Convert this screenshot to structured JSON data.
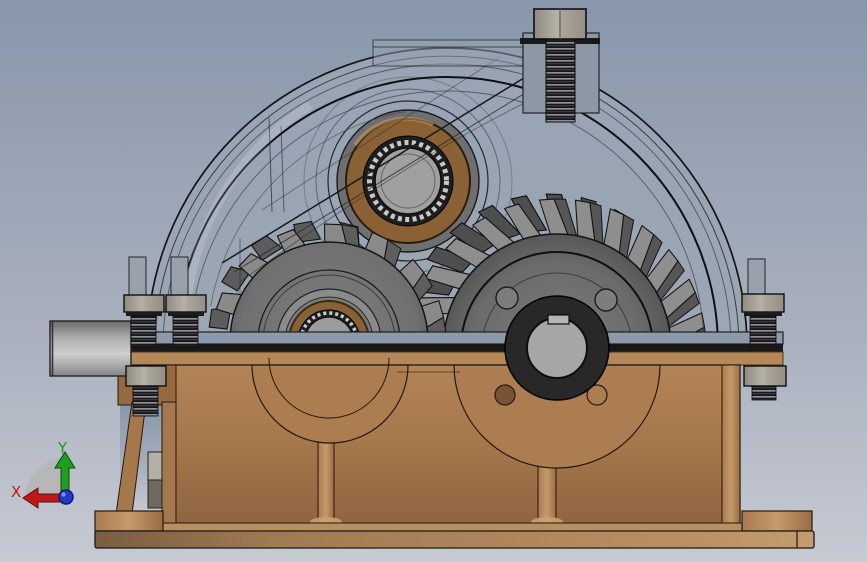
{
  "viewport": {
    "description": "CAD 3D viewport, side view of a single-stage gear reducer assembly",
    "background_top_color": "#8897ab",
    "background_bottom_color": "#c6cad3"
  },
  "orientation_triad": {
    "x_axis_label": "X",
    "y_axis_label": "Y",
    "x_axis_color": "#c01818",
    "y_axis_color": "#1f9e1f",
    "z_axis_color": "#2438c8",
    "sector_color": "#b6b6b6"
  },
  "model": {
    "name": "gear-reducer-assembly",
    "parts": {
      "housing_cover": {
        "label": "transparent-dome-cover",
        "color": "#9aa5b4"
      },
      "housing_base": {
        "label": "copper-housing-base",
        "color": "#a97c52"
      },
      "large_helical_gear": {
        "label": "output-helical-gear",
        "color": "#6e6e6e"
      },
      "small_spur_gear": {
        "label": "input-spur-gear",
        "color": "#8a8a8a"
      },
      "upper_bearing": {
        "label": "input-shaft-bearing",
        "color": "#8a6134"
      },
      "output_shaft": {
        "label": "output-shaft-bore",
        "color": "#a6a6a6"
      },
      "input_shaft": {
        "label": "protruding-shaft",
        "color": "#b8b8b8"
      },
      "fasteners": {
        "label": "hex-nuts-and-studs",
        "color": "#a8a29a"
      }
    }
  }
}
